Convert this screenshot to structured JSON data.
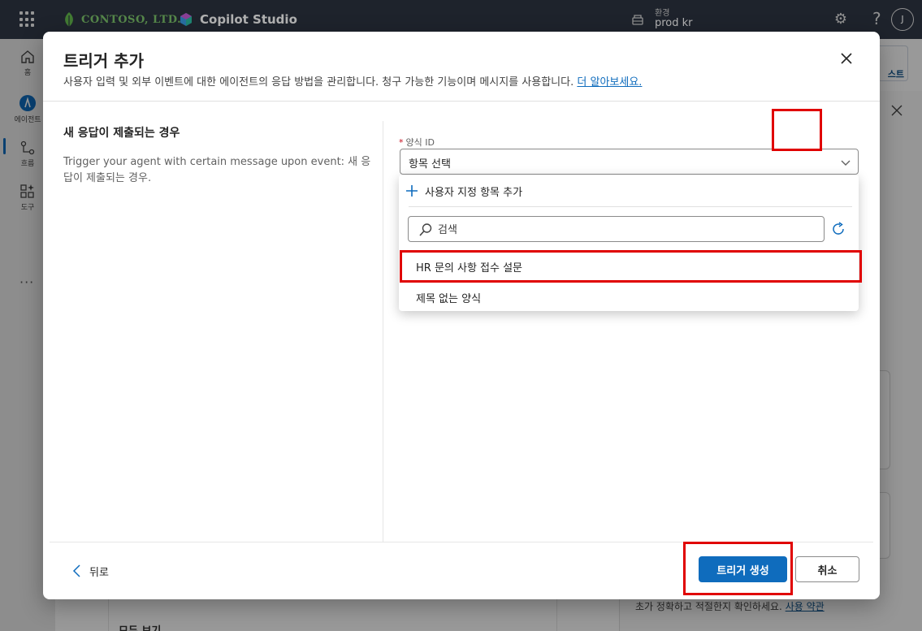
{
  "topbar": {
    "org_name": "CONTOSO, LTD.",
    "product_name": "Copilot Studio",
    "environment_label": "환경",
    "environment_value": "prod kr",
    "help_label": "?",
    "avatar_initial": "J"
  },
  "rail": {
    "items": [
      {
        "label": "홈",
        "icon": "home-icon"
      },
      {
        "label": "에이전트",
        "icon": "agent-icon"
      },
      {
        "label": "흐름",
        "icon": "flow-icon"
      },
      {
        "label": "도구",
        "icon": "tools-icon"
      }
    ],
    "more_label": "···"
  },
  "background": {
    "test_button_label": "스트",
    "notice_text": "초가 정확하고 적절한지 확인하세요.",
    "notice_link": "사용 약관",
    "view_all": "모두 보기"
  },
  "dialog": {
    "title": "트리거 추가",
    "subtitle": "사용자 입력 및 외부 이벤트에 대한 에이전트의 응답 방법을 관리합니다. 청구 가능한 기능이며 메시지를 사용합니다.",
    "subtitle_link": "더 알아보세요.",
    "left_heading": "새 응답이 제출되는 경우",
    "left_description": "Trigger your agent with certain message upon event: 새 응답이 제출되는 경우.",
    "form_field": {
      "label": "양식 ID",
      "required_mark": "*",
      "value": "항목 선택"
    },
    "dropdown": {
      "add_custom_label": "사용자 지정 항목 추가",
      "search_placeholder": "검색",
      "options": [
        "HR 문의 사항 접수 설문",
        "제목 없는 양식"
      ]
    },
    "back_label": "뒤로",
    "create_label": "트리거 생성",
    "cancel_label": "취소"
  },
  "colors": {
    "accent": "#0f6cbd",
    "topbar": "#2b3340",
    "highlight": "#e00000"
  }
}
